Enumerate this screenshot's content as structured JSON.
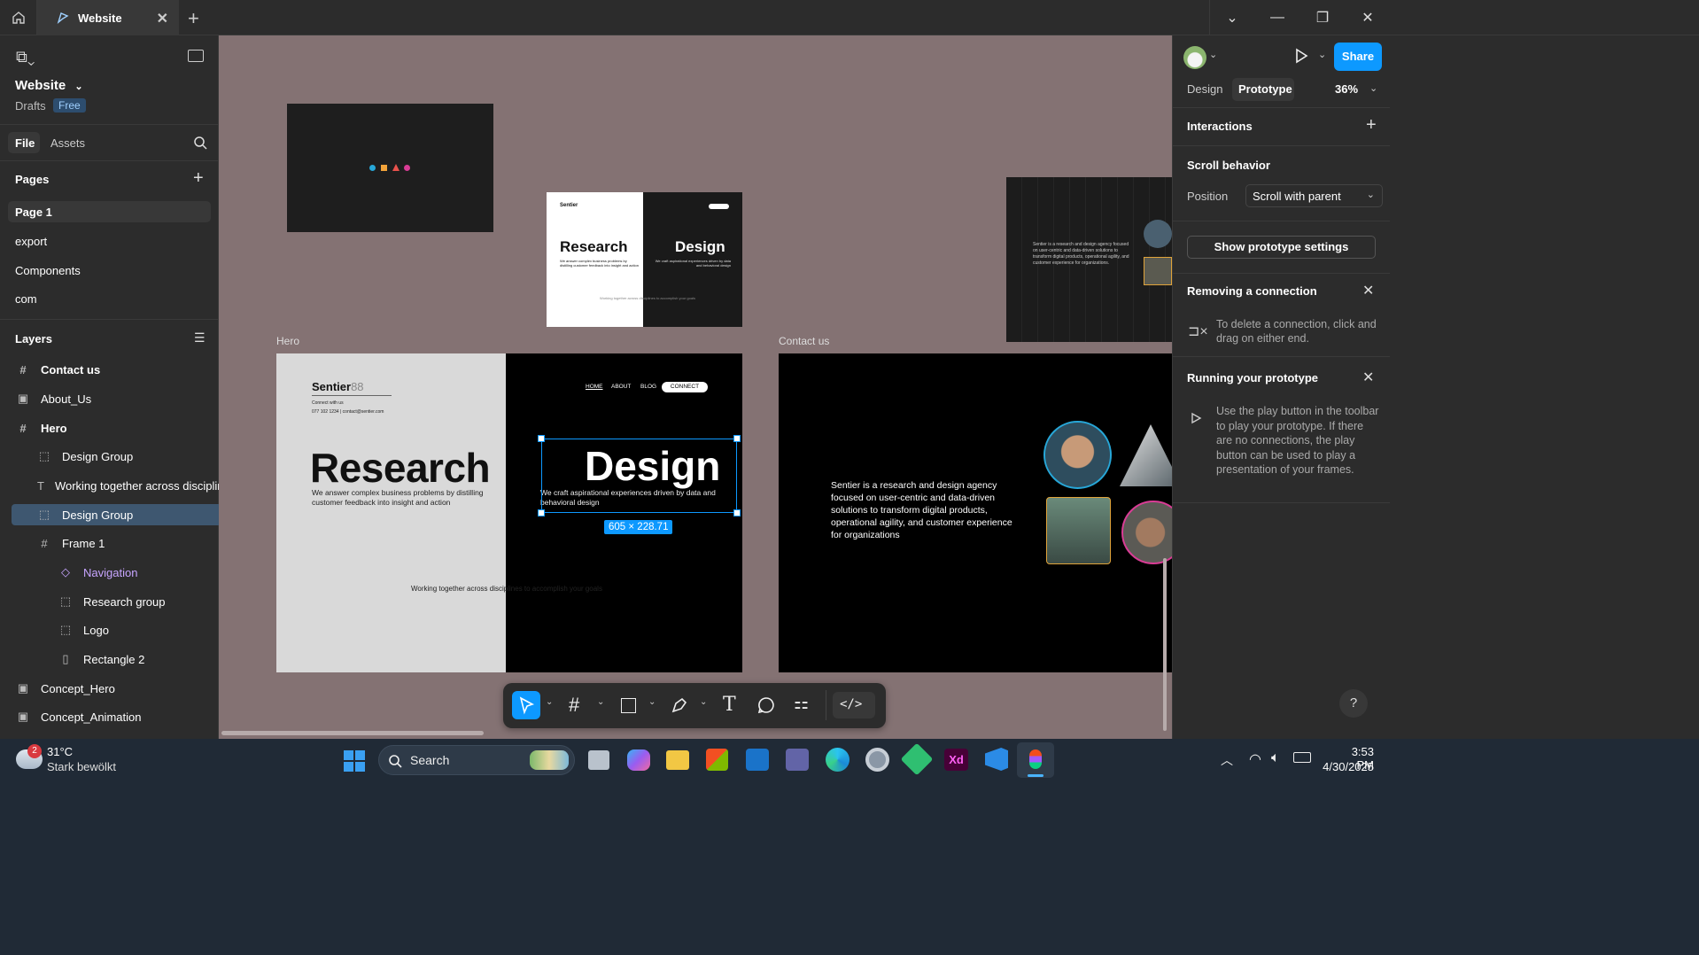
{
  "titlebar": {
    "tab_title": "Website"
  },
  "file": {
    "name": "Website",
    "drafts_label": "Drafts",
    "plan_badge": "Free"
  },
  "left_tabs": {
    "file": "File",
    "assets": "Assets"
  },
  "pages": {
    "header": "Pages",
    "items": [
      {
        "label": "Page 1"
      },
      {
        "label": "export"
      },
      {
        "label": "Components"
      },
      {
        "label": "com"
      }
    ]
  },
  "layers": {
    "header": "Layers",
    "items": [
      {
        "label": "Contact us"
      },
      {
        "label": "About_Us"
      },
      {
        "label": "Hero"
      },
      {
        "label": "Design Group"
      },
      {
        "label": "Working together across disciplin"
      },
      {
        "label": "Design Group"
      },
      {
        "label": "Frame 1"
      },
      {
        "label": "Navigation"
      },
      {
        "label": "Research group"
      },
      {
        "label": "Logo"
      },
      {
        "label": "Rectangle 2"
      },
      {
        "label": "Concept_Hero"
      },
      {
        "label": "Concept_Animation"
      }
    ]
  },
  "canvas": {
    "hero_label": "Hero",
    "contact_label": "Contact us",
    "logo_text": "Sentier",
    "logo_mark": "88",
    "connect_with_us": "Connect with us",
    "contact_line": "077 102 1234 | contact@sentier.com",
    "nav": [
      "HOME",
      "ABOUT",
      "BLOG"
    ],
    "nav_connect": "CONNECT",
    "research_title": "Research",
    "research_desc": "We answer complex business problems by distilling customer feedback into insight and action",
    "design_title": "Design",
    "design_desc": "We craft aspirational experiences driven by data and behavioral design",
    "tagline": "Working together across disciplines to accomplish your goals",
    "selection_size": "605 × 228.71",
    "contact_text": "Sentier is a  research and design agency focused on user-centric and data-driven solutions to transform digital products, operational agility, and customer experience for organizations",
    "small_card_text": "Sentier is a research and design agency focused on user-centric and data-driven solutions to transform digital products, operational agility, and customer experience for organizations."
  },
  "right_panel": {
    "share_label": "Share",
    "tabs": {
      "design": "Design",
      "prototype": "Prototype"
    },
    "zoom": "36%",
    "interactions": "Interactions",
    "scroll_behavior": "Scroll behavior",
    "position_label": "Position",
    "position_value": "Scroll with parent",
    "show_proto_settings": "Show prototype settings",
    "removing_title": "Removing a connection",
    "removing_text": "To delete a connection, click and drag on either end.",
    "running_title": "Running your prototype",
    "running_text": "Use the play button in the toolbar to play your prototype. If there are no connections, the play button can be used to play a presentation of your frames.",
    "help": "?"
  },
  "taskbar": {
    "badge_count": "2",
    "temperature": "31°C",
    "weather": "Stark bewölkt",
    "search": "Search",
    "time": "3:53 PM",
    "date": "4/30/2025"
  },
  "colors": {
    "accent": "#0d99ff",
    "canvas": "#847273",
    "panel": "#2c2c2c",
    "purple": "#c7a5ff"
  }
}
